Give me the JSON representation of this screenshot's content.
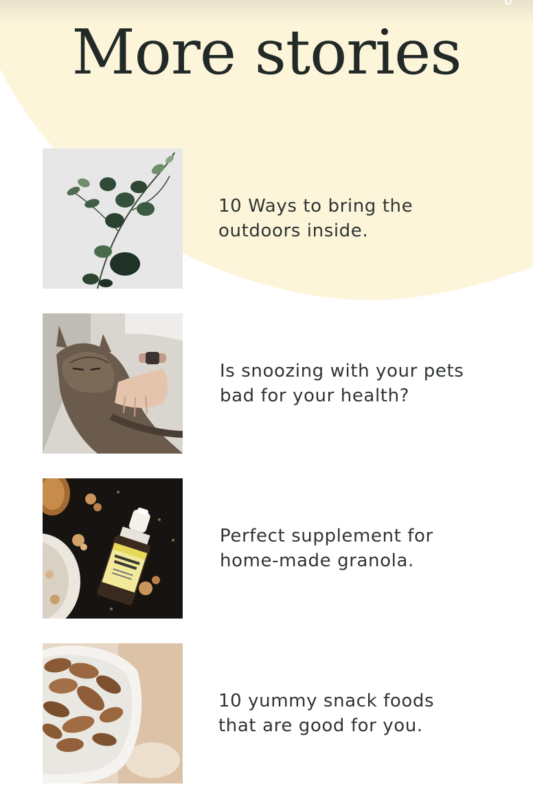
{
  "section": {
    "title": "More stories"
  },
  "stories": [
    {
      "title": "10 Ways to bring the\noutdoors inside.",
      "image": "eucalyptus-plant"
    },
    {
      "title": "Is snoozing with your pets\nbad for your health?",
      "image": "sleeping-cat"
    },
    {
      "title": "Perfect supplement for\nhome-made granola.",
      "image": "hemp-extract-bottle"
    },
    {
      "title": "10 yummy snack foods\nthat are good for you.",
      "image": "almond-bowl"
    }
  ],
  "colors": {
    "background": "#ffffff",
    "accent_blob": "#fdf5da",
    "title_text": "#222a28",
    "body_text": "#2f3433"
  }
}
